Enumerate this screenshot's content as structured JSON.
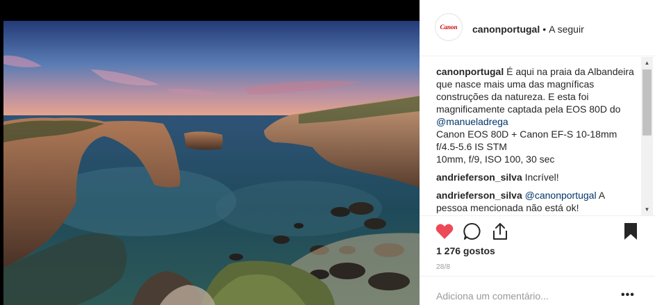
{
  "post": {
    "username": "canonportugal",
    "separator": "•",
    "follow_label": "A seguir",
    "avatar_text": "Canon",
    "caption": {
      "user": "canonportugal",
      "text_1": "É aqui na praia da Albandeira que nasce mais uma das magníficas construções da natureza. E esta foi magnificamente captada pela EOS 80D do",
      "mention": "@manueladrega",
      "line_2": "Canon EOS 80D + Canon EF-S 10-18mm f/4.5-5.6 IS STM",
      "line_3": "10mm, f/9, ISO 100, 30 sec"
    },
    "comments": [
      {
        "user": "andrieferson_silva",
        "text": "Incrível!",
        "mention": ""
      },
      {
        "user": "andrieferson_silva",
        "text": "A pessoa mencionada não está ok!",
        "mention": "@canonportugal"
      }
    ],
    "likes_label": "1 276 gostos",
    "date": "28/8",
    "comment_placeholder": "Adiciona um comentário...",
    "more_label": "•••"
  },
  "colors": {
    "like_red": "#ed4956",
    "text": "#262626",
    "mention": "#003569",
    "muted": "#999999"
  },
  "icons": {
    "like": "heart-icon",
    "comment": "comment-bubble-icon",
    "share": "share-icon",
    "save": "bookmark-icon"
  }
}
